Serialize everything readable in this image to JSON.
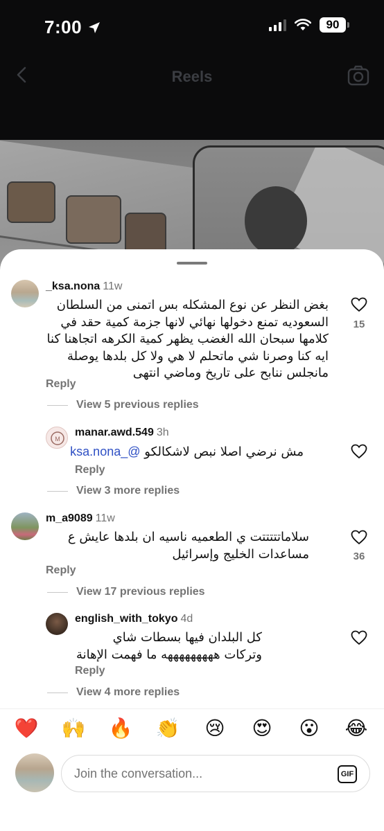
{
  "status": {
    "time": "7:00",
    "battery": "90"
  },
  "header": {
    "title": "Reels"
  },
  "comments": [
    {
      "username": "_ksa.nona",
      "time": "11w",
      "text": "بغض النظر عن نوع المشكله بس اتمنى من السلطان السعوديه تمنع دخولها نهائي لانها جزمة كمية حقد في كلامها سبحان الله الغضب يظهر كمية الكرهه اتجاهنا كنا ايه كنا وصرنا شي ماتحلم لا هي ولا كل بلدها يوصلة مانجلس ننابح على تاريخ وماضي انتهى",
      "reply": "Reply",
      "likes": "15",
      "view_replies": "View 5 previous replies"
    },
    {
      "username": "manar.awd.549",
      "time": "3h",
      "mention": "@_ksa.nona",
      "text": "مش نرضي اصلا نبص لاشكالكو",
      "reply": "Reply",
      "view_replies": "View 3 more replies"
    },
    {
      "username": "m_a9089",
      "time": "11w",
      "text": "سلاماتتتتتت ي الطعميه ناسيه ان بلدها عايش ع مساعدات الخليج وإسرائيل",
      "reply": "Reply",
      "likes": "36",
      "view_replies": "View 17 previous replies"
    },
    {
      "username": "english_with_tokyo",
      "time": "4d",
      "text": "كل البلدان فيها بسطات شاي وتركات هههههههههه ما فهمت الإهانة",
      "reply": "Reply",
      "view_replies": "View 4 more replies"
    }
  ],
  "emojis": [
    "❤️",
    "🙌",
    "🔥",
    "👏",
    "😢",
    "😍",
    "😮",
    "😂"
  ],
  "composer": {
    "placeholder": "Join the conversation...",
    "gif_label": "GIF"
  },
  "colors": {
    "mention": "#2f50c4",
    "muted": "#737373",
    "like_heart": "#111111"
  }
}
